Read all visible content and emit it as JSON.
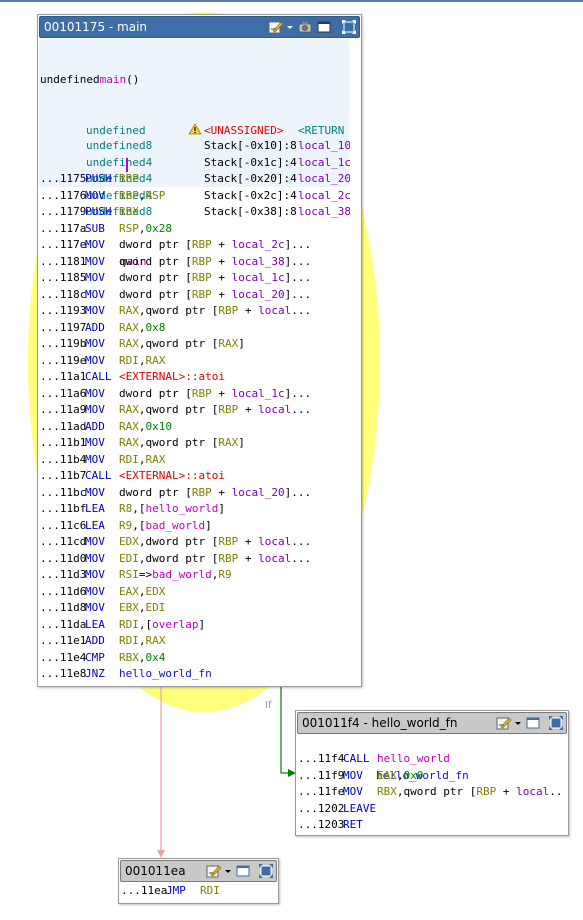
{
  "blocks": {
    "main": {
      "title": "00101175 - main",
      "header": {
        "signature": {
          "type": "undefined",
          "name": "main",
          "args": "()"
        },
        "vars": [
          {
            "type": "undefined",
            "warn": true,
            "storage": "<UNASSIGNED>",
            "name": "<RETURN"
          },
          {
            "type": "undefined8",
            "storage": "Stack[-0x10]:8",
            "name": "local_10"
          },
          {
            "type": "undefined4",
            "storage": "Stack[-0x1c]:4",
            "name": "local_1c"
          },
          {
            "type": "undefined4",
            "storage": "Stack[-0x20]:4",
            "name": "local_20"
          },
          {
            "type": "undefined4",
            "storage": "Stack[-0x2c]:4",
            "name": "local_2c"
          },
          {
            "type": "undefined8",
            "storage": "Stack[-0x38]:8",
            "name": "local_38"
          }
        ],
        "label": "main"
      },
      "lines": [
        {
          "addr": "...1175",
          "mn": "PUSH",
          "ops": [
            [
              "reg",
              "RBP"
            ]
          ]
        },
        {
          "addr": "...1176",
          "mn": "MOV",
          "ops": [
            [
              "reg",
              "RBP"
            ],
            [
              "p",
              ","
            ],
            [
              "reg",
              "RSP"
            ]
          ]
        },
        {
          "addr": "...1179",
          "mn": "PUSH",
          "ops": [
            [
              "reg",
              "RBX"
            ]
          ]
        },
        {
          "addr": "...117a",
          "mn": "SUB",
          "ops": [
            [
              "reg",
              "RSP"
            ],
            [
              "p",
              ","
            ],
            [
              "num",
              "0x28"
            ]
          ]
        },
        {
          "addr": "...117e",
          "mn": "MOV",
          "ops": [
            [
              "p",
              "dword ptr ["
            ],
            [
              "reg",
              "RBP"
            ],
            [
              "p",
              " + "
            ],
            [
              "loc",
              "local_2c"
            ],
            [
              "p",
              "]..."
            ]
          ]
        },
        {
          "addr": "...1181",
          "mn": "MOV",
          "ops": [
            [
              "p",
              "qword ptr ["
            ],
            [
              "reg",
              "RBP"
            ],
            [
              "p",
              " + "
            ],
            [
              "loc",
              "local_38"
            ],
            [
              "p",
              "]..."
            ]
          ]
        },
        {
          "addr": "...1185",
          "mn": "MOV",
          "ops": [
            [
              "p",
              "dword ptr ["
            ],
            [
              "reg",
              "RBP"
            ],
            [
              "p",
              " + "
            ],
            [
              "loc",
              "local_1c"
            ],
            [
              "p",
              "]..."
            ]
          ]
        },
        {
          "addr": "...118c",
          "mn": "MOV",
          "ops": [
            [
              "p",
              "dword ptr ["
            ],
            [
              "reg",
              "RBP"
            ],
            [
              "p",
              " + "
            ],
            [
              "loc",
              "local_20"
            ],
            [
              "p",
              "]..."
            ]
          ]
        },
        {
          "addr": "...1193",
          "mn": "MOV",
          "ops": [
            [
              "reg",
              "RAX"
            ],
            [
              "p",
              ",qword ptr ["
            ],
            [
              "reg",
              "RBP"
            ],
            [
              "p",
              " + "
            ],
            [
              "loc",
              "local"
            ],
            [
              "p",
              "..."
            ]
          ]
        },
        {
          "addr": "...1197",
          "mn": "ADD",
          "ops": [
            [
              "reg",
              "RAX"
            ],
            [
              "p",
              ","
            ],
            [
              "num",
              "0x8"
            ]
          ]
        },
        {
          "addr": "...119b",
          "mn": "MOV",
          "ops": [
            [
              "reg",
              "RAX"
            ],
            [
              "p",
              ",qword ptr ["
            ],
            [
              "reg",
              "RAX"
            ],
            [
              "p",
              "]"
            ]
          ]
        },
        {
          "addr": "...119e",
          "mn": "MOV",
          "ops": [
            [
              "reg",
              "RDI"
            ],
            [
              "p",
              ","
            ],
            [
              "reg",
              "RAX"
            ]
          ]
        },
        {
          "addr": "...11a1",
          "mn": "CALL",
          "ops": [
            [
              "ext",
              "<EXTERNAL>::atoi"
            ]
          ]
        },
        {
          "addr": "...11a6",
          "mn": "MOV",
          "ops": [
            [
              "p",
              "dword ptr ["
            ],
            [
              "reg",
              "RBP"
            ],
            [
              "p",
              " + "
            ],
            [
              "loc",
              "local_1c"
            ],
            [
              "p",
              "]..."
            ]
          ]
        },
        {
          "addr": "...11a9",
          "mn": "MOV",
          "ops": [
            [
              "reg",
              "RAX"
            ],
            [
              "p",
              ",qword ptr ["
            ],
            [
              "reg",
              "RBP"
            ],
            [
              "p",
              " + "
            ],
            [
              "loc",
              "local"
            ],
            [
              "p",
              "..."
            ]
          ]
        },
        {
          "addr": "...11ad",
          "mn": "ADD",
          "ops": [
            [
              "reg",
              "RAX"
            ],
            [
              "p",
              ","
            ],
            [
              "num",
              "0x10"
            ]
          ]
        },
        {
          "addr": "...11b1",
          "mn": "MOV",
          "ops": [
            [
              "reg",
              "RAX"
            ],
            [
              "p",
              ",qword ptr ["
            ],
            [
              "reg",
              "RAX"
            ],
            [
              "p",
              "]"
            ]
          ]
        },
        {
          "addr": "...11b4",
          "mn": "MOV",
          "ops": [
            [
              "reg",
              "RDI"
            ],
            [
              "p",
              ","
            ],
            [
              "reg",
              "RAX"
            ]
          ]
        },
        {
          "addr": "...11b7",
          "mn": "CALL",
          "ops": [
            [
              "ext",
              "<EXTERNAL>::atoi"
            ]
          ]
        },
        {
          "addr": "...11bc",
          "mn": "MOV",
          "ops": [
            [
              "p",
              "dword ptr ["
            ],
            [
              "reg",
              "RBP"
            ],
            [
              "p",
              " + "
            ],
            [
              "loc",
              "local_20"
            ],
            [
              "p",
              "]..."
            ]
          ]
        },
        {
          "addr": "...11bf",
          "mn": "LEA",
          "ops": [
            [
              "reg",
              "R8"
            ],
            [
              "p",
              ",["
            ],
            [
              "fnc",
              "hello_world"
            ],
            [
              "p",
              "]"
            ]
          ]
        },
        {
          "addr": "...11c6",
          "mn": "LEA",
          "ops": [
            [
              "reg",
              "R9"
            ],
            [
              "p",
              ",["
            ],
            [
              "fnc",
              "bad_world"
            ],
            [
              "p",
              "]"
            ]
          ]
        },
        {
          "addr": "...11cd",
          "mn": "MOV",
          "ops": [
            [
              "reg",
              "EDX"
            ],
            [
              "p",
              ",dword ptr ["
            ],
            [
              "reg",
              "RBP"
            ],
            [
              "p",
              " + "
            ],
            [
              "loc",
              "local"
            ],
            [
              "p",
              "..."
            ]
          ]
        },
        {
          "addr": "...11d0",
          "mn": "MOV",
          "ops": [
            [
              "reg",
              "EDI"
            ],
            [
              "p",
              ",dword ptr ["
            ],
            [
              "reg",
              "RBP"
            ],
            [
              "p",
              " + "
            ],
            [
              "loc",
              "local"
            ],
            [
              "p",
              "..."
            ]
          ]
        },
        {
          "addr": "...11d3",
          "mn": "MOV",
          "ops": [
            [
              "reg",
              "RSI"
            ],
            [
              "p",
              "=>"
            ],
            [
              "fnc",
              "bad_world"
            ],
            [
              "p",
              ","
            ],
            [
              "reg",
              "R9"
            ]
          ]
        },
        {
          "addr": "...11d6",
          "mn": "MOV",
          "ops": [
            [
              "reg",
              "EAX"
            ],
            [
              "p",
              ","
            ],
            [
              "reg",
              "EDX"
            ]
          ]
        },
        {
          "addr": "...11d8",
          "mn": "MOV",
          "ops": [
            [
              "reg",
              "EBX"
            ],
            [
              "p",
              ","
            ],
            [
              "reg",
              "EDI"
            ]
          ]
        },
        {
          "addr": "...11da",
          "mn": "LEA",
          "ops": [
            [
              "reg",
              "RDI"
            ],
            [
              "p",
              ",["
            ],
            [
              "fnc",
              "overlap"
            ],
            [
              "p",
              "]"
            ]
          ]
        },
        {
          "addr": "...11e1",
          "mn": "ADD",
          "ops": [
            [
              "reg",
              "RDI"
            ],
            [
              "p",
              ","
            ],
            [
              "reg",
              "RAX"
            ]
          ]
        },
        {
          "addr": "...11e4",
          "mn": "CMP",
          "ops": [
            [
              "reg",
              "RBX"
            ],
            [
              "p",
              ","
            ],
            [
              "num",
              "0x4"
            ]
          ]
        },
        {
          "addr": "...11e8",
          "mn": "JNZ",
          "ops": [
            [
              "lbl",
              "hello_world_fn"
            ]
          ]
        }
      ]
    },
    "hello": {
      "title": "001011f4 - hello_world_fn",
      "label": "hello_world_fn",
      "lines": [
        {
          "addr": "...11f4",
          "mn": "CALL",
          "ops": [
            [
              "fnc",
              "hello_world"
            ]
          ]
        },
        {
          "addr": "...11f9",
          "mn": "MOV",
          "ops": [
            [
              "reg",
              "EAX"
            ],
            [
              "p",
              ","
            ],
            [
              "num",
              "0x0"
            ]
          ]
        },
        {
          "addr": "...11fe",
          "mn": "MOV",
          "ops": [
            [
              "reg",
              "RBX"
            ],
            [
              "p",
              ",qword ptr ["
            ],
            [
              "reg",
              "RBP"
            ],
            [
              "p",
              " + "
            ],
            [
              "loc",
              "local"
            ],
            [
              "p",
              "..."
            ]
          ]
        },
        {
          "addr": "...1202",
          "mn": "LEAVE",
          "ops": []
        },
        {
          "addr": "...1203",
          "mn": "RET",
          "ops": []
        }
      ]
    },
    "ret": {
      "title": "001011ea",
      "lines": [
        {
          "addr": "...11ea",
          "mn": "JMP",
          "ops": [
            [
              "reg",
              "RDI"
            ]
          ]
        }
      ]
    }
  },
  "edges": {
    "branch_label": "If"
  },
  "colors": {
    "title_active": "#3d6ea7",
    "title_inactive": "#c9c9c9",
    "edge_true": "#008000",
    "edge_fall": "#f0a0a0",
    "highlight": "#ffff7a"
  }
}
